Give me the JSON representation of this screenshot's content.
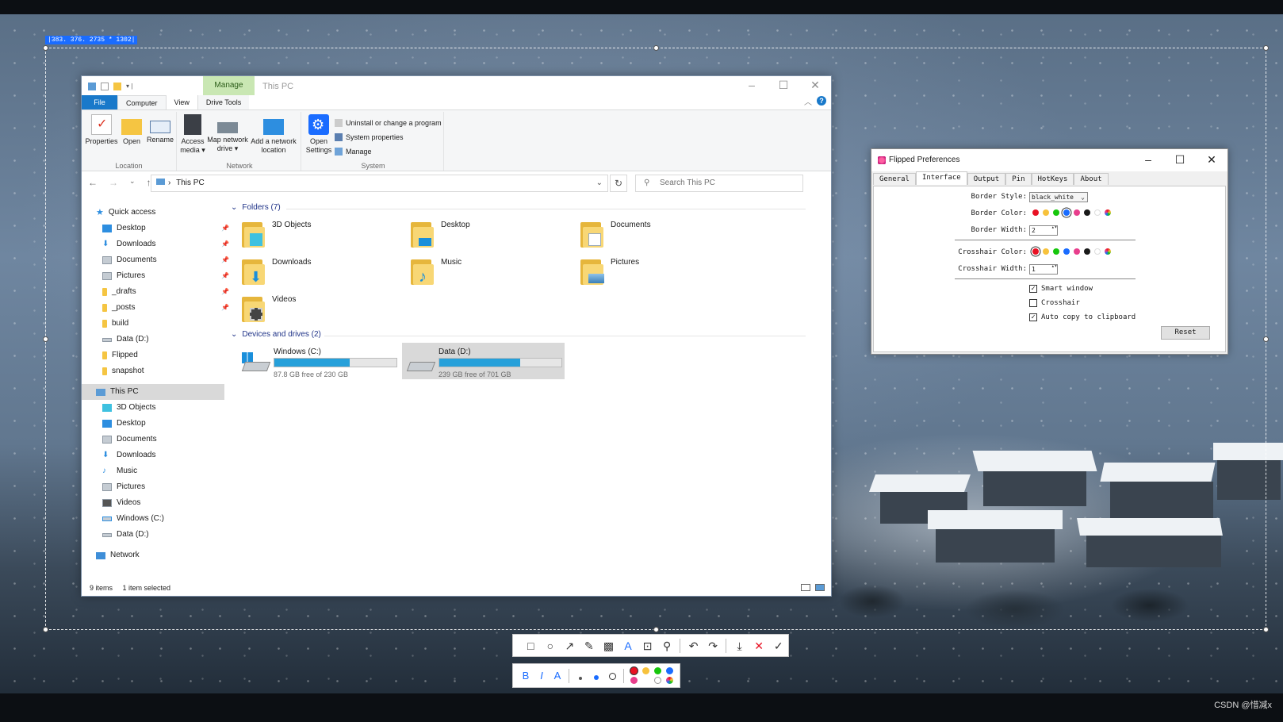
{
  "selection": {
    "coords_label": "|383. 376. 2735 * 1302|"
  },
  "explorer": {
    "manage_tab": "Manage",
    "title": "This PC",
    "tabs": {
      "file": "File",
      "computer": "Computer",
      "view": "View",
      "drive_tools": "Drive Tools"
    },
    "ribbon": {
      "location": {
        "label": "Location",
        "properties": "Properties",
        "open": "Open",
        "rename": "Rename"
      },
      "network": {
        "label": "Network",
        "access_media_1": "Access",
        "access_media_2": "media",
        "map_drive_1": "Map network",
        "map_drive_2": "drive",
        "add_location_1": "Add a network",
        "add_location_2": "location"
      },
      "system": {
        "label": "System",
        "open_settings_1": "Open",
        "open_settings_2": "Settings",
        "uninstall": "Uninstall or change a program",
        "sys_props": "System properties",
        "manage": "Manage"
      }
    },
    "address": "This PC",
    "search_placeholder": "Search This PC",
    "nav": {
      "quick_access": "Quick access",
      "qa_items": [
        "Desktop",
        "Downloads",
        "Documents",
        "Pictures",
        "_drafts",
        "_posts",
        "build",
        "Data (D:)",
        "Flipped",
        "snapshot"
      ],
      "this_pc": "This PC",
      "pc_items": [
        "3D Objects",
        "Desktop",
        "Documents",
        "Downloads",
        "Music",
        "Pictures",
        "Videos",
        "Windows (C:)",
        "Data (D:)"
      ],
      "network": "Network"
    },
    "folders_header": "Folders (7)",
    "folders": [
      "3D Objects",
      "Desktop",
      "Documents",
      "Downloads",
      "Music",
      "Pictures",
      "Videos"
    ],
    "drives_header": "Devices and drives (2)",
    "drives": [
      {
        "name": "Windows (C:)",
        "free": "87.8 GB free of 230 GB",
        "used_fraction": 0.62
      },
      {
        "name": "Data (D:)",
        "free": "239 GB free of 701 GB",
        "used_fraction": 0.66
      }
    ],
    "status": {
      "items": "9 items",
      "selected": "1 item selected"
    }
  },
  "prefs": {
    "title": "Flipped Preferences",
    "tabs": [
      "General",
      "Interface",
      "Output",
      "Pin",
      "HotKeys",
      "About"
    ],
    "border_style_label": "Border Style:",
    "border_style_value": "black_white",
    "border_color_label": "Border Color:",
    "border_width_label": "Border Width:",
    "border_width_value": "2",
    "crosshair_color_label": "Crosshair Color:",
    "crosshair_width_label": "Crosshair Width:",
    "crosshair_width_value": "1",
    "smart_window": "Smart window",
    "crosshair": "Crosshair",
    "auto_copy": "Auto copy to clipboard",
    "reset": "Reset",
    "palette": [
      "#e81123",
      "#f7c23c",
      "#16c60c",
      "#1a6cff",
      "#e83e8c",
      "#1a1a1a",
      "#ffffff"
    ]
  },
  "watermark": "CSDN @惜减x"
}
